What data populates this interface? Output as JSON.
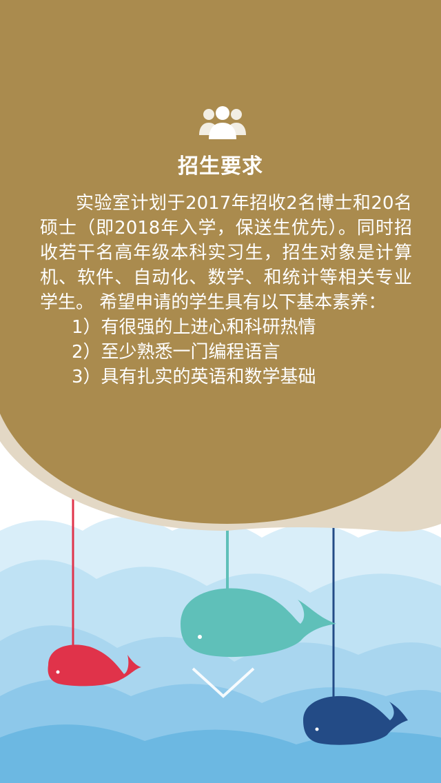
{
  "section": {
    "title": "招生要求",
    "icon": "people-group-icon"
  },
  "intro_text": "实验室计划于2017年招收2名博士和20名硕士（即2018年入学，保送生优先）。同时招收若干名高年级本科实习生，招生对象是计算机、软件、自动化、数学、和统计等相关专业学生。 希望申请的学生具有以下基本素养：",
  "requirements": [
    "1）有很强的上进心和科研热情",
    "2）至少熟悉一门编程语言",
    "3）具有扎实的英语和数学基础"
  ],
  "decorations": {
    "whales": [
      "red-whale",
      "teal-whale",
      "navy-whale"
    ],
    "scroll_hint_icon": "chevron-down-icon"
  },
  "colors": {
    "card": "#AA8B4E",
    "card_shadow": "#E3D8C5",
    "cloud_light": "#D9EEF9",
    "cloud_mid": "#A9D6EF",
    "cloud_dark": "#6CB8E2",
    "whale_red": "#E0334A",
    "whale_teal": "#5FC0B9",
    "whale_navy": "#234B86"
  }
}
